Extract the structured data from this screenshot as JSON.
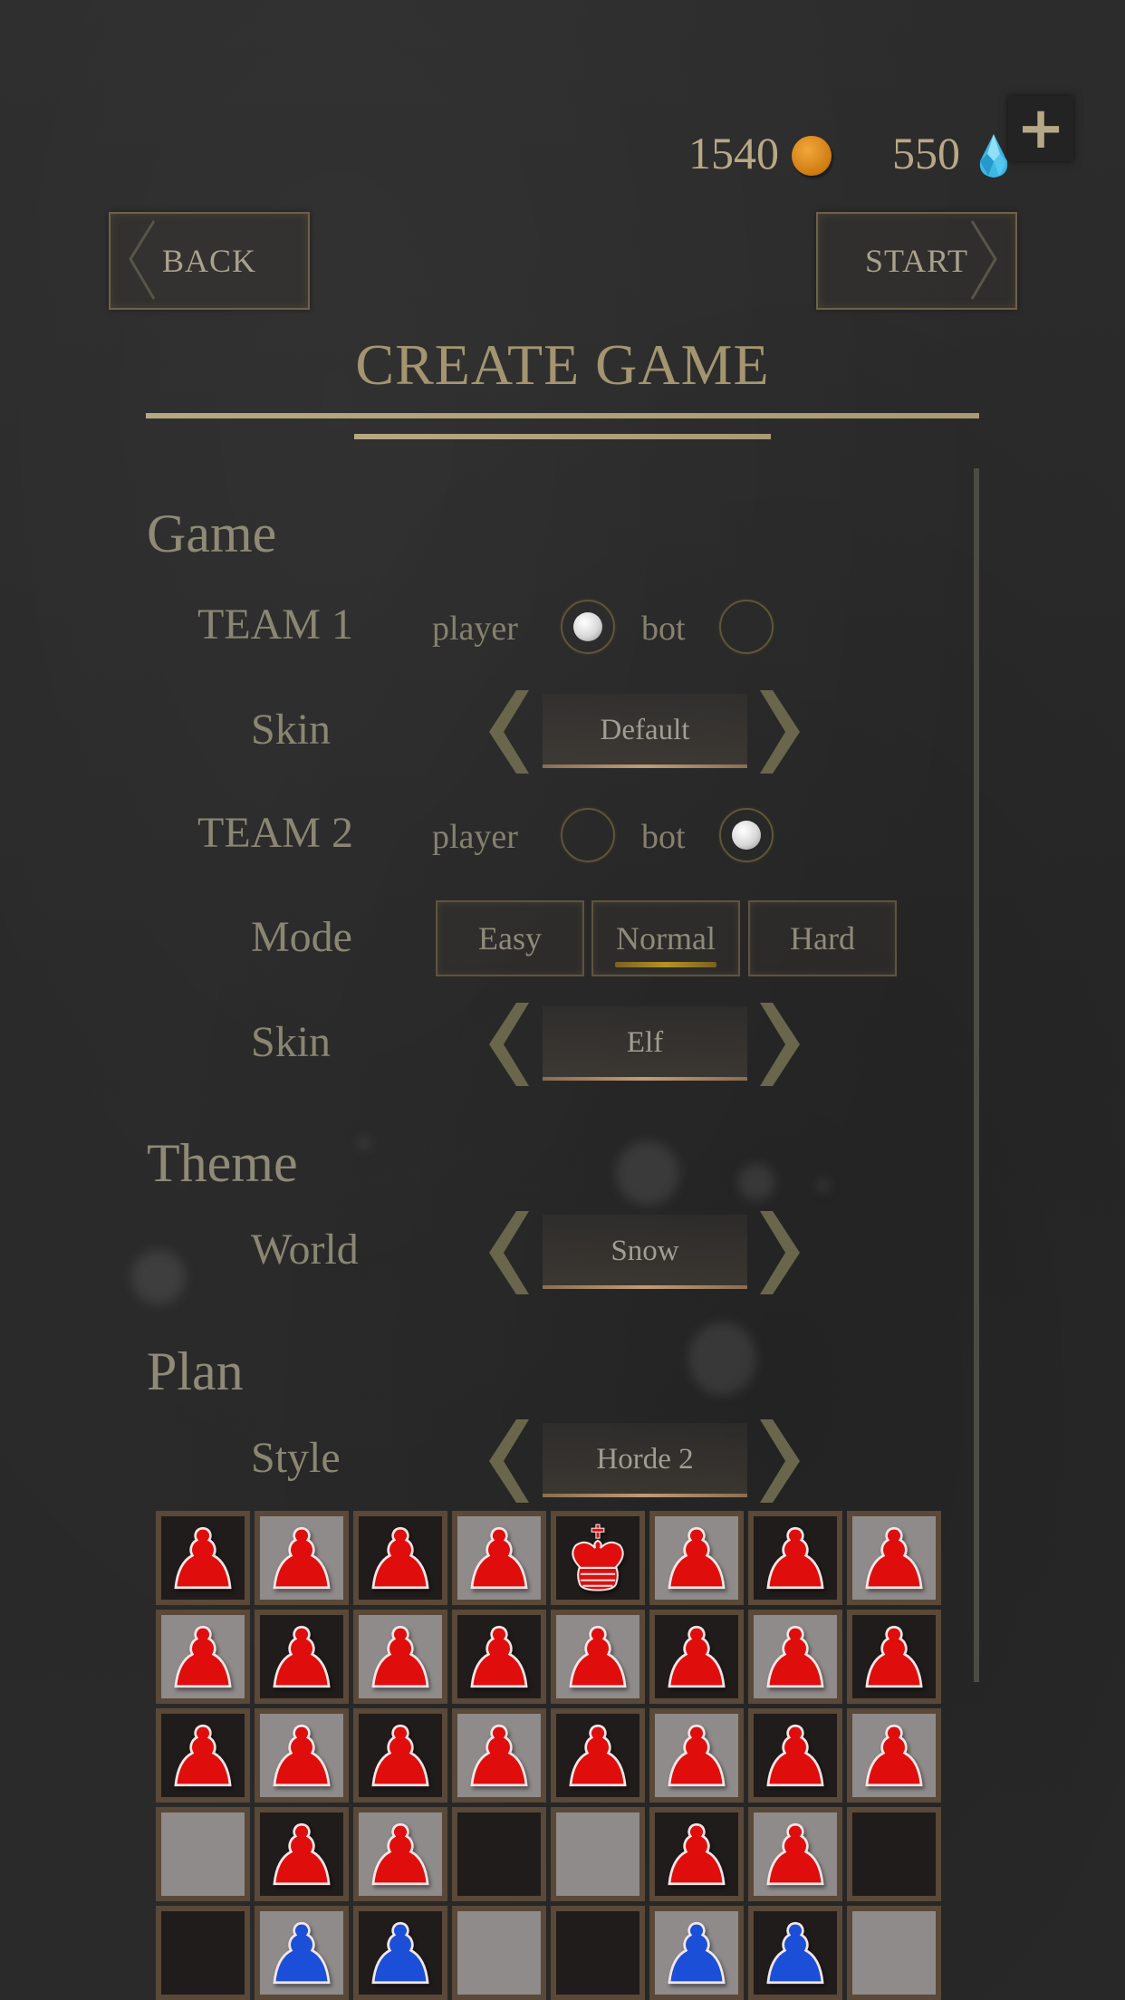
{
  "currency": {
    "coins": "1540",
    "gems": "550",
    "coin_icon": "gold-coin-icon",
    "gem_icon": "blue-gem-icon",
    "add_button_icon": "plus-icon",
    "add_button_label": "+"
  },
  "nav": {
    "back_label": "BACK",
    "start_label": "START"
  },
  "title": "CREATE GAME",
  "sections": {
    "game": {
      "heading": "Game",
      "team1": {
        "label": "TEAM 1",
        "option_player": "player",
        "option_bot": "bot",
        "selected": "player",
        "skin_label": "Skin",
        "skin_value": "Default"
      },
      "team2": {
        "label": "TEAM 2",
        "option_player": "player",
        "option_bot": "bot",
        "selected": "bot",
        "mode_label": "Mode",
        "modes": [
          "Easy",
          "Normal",
          "Hard"
        ],
        "selected_mode": "Normal",
        "skin_label": "Skin",
        "skin_value": "Elf"
      }
    },
    "theme": {
      "heading": "Theme",
      "world_label": "World",
      "world_value": "Snow"
    },
    "plan": {
      "heading": "Plan",
      "style_label": "Style",
      "style_value": "Horde 2"
    }
  },
  "board": {
    "colors": {
      "red": "#e00d0d",
      "blue": "#1c4fd8",
      "dark": "#201c1b",
      "light": "#8e8b8a",
      "frame": "#5a4838"
    },
    "rows": [
      [
        "red-pawn",
        "red-pawn",
        "red-pawn",
        "red-pawn",
        "red-king",
        "red-pawn",
        "red-pawn",
        "red-pawn"
      ],
      [
        "red-pawn",
        "red-pawn",
        "red-pawn",
        "red-pawn",
        "red-pawn",
        "red-pawn",
        "red-pawn",
        "red-pawn"
      ],
      [
        "red-pawn",
        "red-pawn",
        "red-pawn",
        "red-pawn",
        "red-pawn",
        "red-pawn",
        "red-pawn",
        "red-pawn"
      ],
      [
        "empty",
        "red-pawn",
        "red-pawn",
        "empty",
        "empty",
        "red-pawn",
        "red-pawn",
        "empty"
      ],
      [
        "empty",
        "blue-pawn",
        "blue-pawn",
        "empty",
        "empty",
        "blue-pawn",
        "blue-pawn",
        "empty"
      ]
    ]
  },
  "colors": {
    "accent_gold": "#a49570",
    "text_muted": "#8a8672",
    "mode_selected_underline": "#b69226"
  }
}
